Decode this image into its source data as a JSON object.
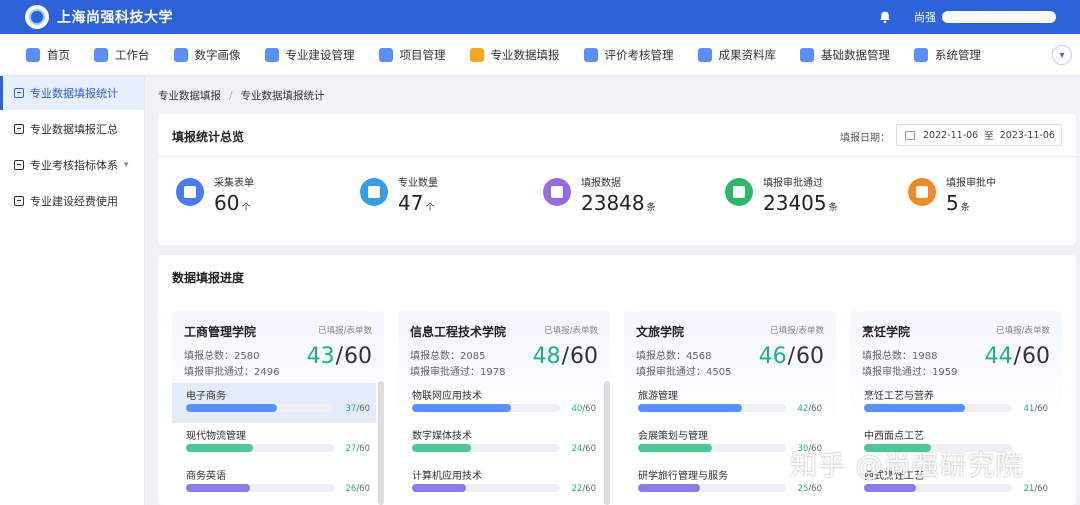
{
  "header": {
    "brand": "上海尚强科技大学",
    "user_label": "尚强"
  },
  "nav": {
    "items": [
      {
        "label": "首页",
        "color": "#5b8ff9"
      },
      {
        "label": "工作台",
        "color": "#5b8ff9"
      },
      {
        "label": "数字画像",
        "color": "#5b8ff9"
      },
      {
        "label": "专业建设管理",
        "color": "#5b8ff9"
      },
      {
        "label": "项目管理",
        "color": "#5b8ff9"
      },
      {
        "label": "专业数据填报",
        "color": "#f5a623"
      },
      {
        "label": "评价考核管理",
        "color": "#5b8ff9"
      },
      {
        "label": "成果资料库",
        "color": "#5b8ff9"
      },
      {
        "label": "基础数据管理",
        "color": "#5b8ff9"
      },
      {
        "label": "系统管理",
        "color": "#5b8ff9"
      }
    ]
  },
  "sidebar": {
    "items": [
      {
        "label": "专业数据填报统计"
      },
      {
        "label": "专业数据填报汇总"
      },
      {
        "label": "专业考核指标体系"
      },
      {
        "label": "专业建设经费使用"
      }
    ]
  },
  "breadcrumb": {
    "first": "专业数据填报",
    "sep": "/",
    "second": "专业数据填报统计"
  },
  "overview": {
    "title": "填报统计总览",
    "date_label": "填报日期：",
    "date_start": "2022-11-06",
    "date_sep": "至",
    "date_end": "2023-11-06",
    "stats": [
      {
        "label": "采集表单",
        "value": "60",
        "unit": "个",
        "color": "#4a7be8"
      },
      {
        "label": "专业数量",
        "value": "47",
        "unit": "个",
        "color": "#3a9be8"
      },
      {
        "label": "填报数据",
        "value": "23848",
        "unit": "条",
        "color": "#9a6be0"
      },
      {
        "label": "填报审批通过",
        "value": "23405",
        "unit": "条",
        "color": "#2fb86a"
      },
      {
        "label": "填报审批中",
        "value": "5",
        "unit": "条",
        "color": "#f08a24"
      }
    ]
  },
  "progress": {
    "title": "数据填报进度",
    "colleges": [
      {
        "name": "工商管理学院",
        "note": "已填报/表单数",
        "total": "填报总数：2580",
        "approved": "填报审批通过：2496",
        "score": "43",
        "slash": "/",
        "out_of": "60",
        "majors": [
          {
            "name": "电子商务",
            "done": "37",
            "total": "/60",
            "progress": 0.6167,
            "color": "#5b8ff9"
          },
          {
            "name": "现代物流管理",
            "done": "27",
            "total": "/60",
            "progress": 0.45,
            "color": "#52c49a"
          },
          {
            "name": "商务英语",
            "done": "26",
            "total": "/60",
            "progress": 0.4333,
            "color": "#8c7ae6"
          }
        ]
      },
      {
        "name": "信息工程技术学院",
        "note": "已填报/表单数",
        "total": "填报总数：2085",
        "approved": "填报审批通过：1978",
        "score": "48",
        "slash": "/",
        "out_of": "60",
        "majors": [
          {
            "name": "物联网应用技术",
            "done": "40",
            "total": "/60",
            "progress": 0.6667,
            "color": "#5b8ff9"
          },
          {
            "name": "数字媒体技术",
            "done": "24",
            "total": "/60",
            "progress": 0.4,
            "color": "#52c49a"
          },
          {
            "name": "计算机应用技术",
            "done": "22",
            "total": "/60",
            "progress": 0.3667,
            "color": "#8c7ae6"
          }
        ]
      },
      {
        "name": "文旅学院",
        "note": "已填报/表单数",
        "total": "填报总数：4568",
        "approved": "填报审批通过：4505",
        "score": "46",
        "slash": "/",
        "out_of": "60",
        "majors": [
          {
            "name": "旅游管理",
            "done": "42",
            "total": "/60",
            "progress": 0.7,
            "color": "#5b8ff9"
          },
          {
            "name": "会展策划与管理",
            "done": "30",
            "total": "/60",
            "progress": 0.5,
            "color": "#52c49a"
          },
          {
            "name": "研学旅行管理与服务",
            "done": "25",
            "total": "/60",
            "progress": 0.4167,
            "color": "#8c7ae6"
          }
        ]
      },
      {
        "name": "烹饪学院",
        "note": "已填报/表单数",
        "total": "填报总数：1988",
        "approved": "填报审批通过：1959",
        "score": "44",
        "slash": "/",
        "out_of": "60",
        "majors": [
          {
            "name": "烹饪工艺与营养",
            "done": "41",
            "total": "/60",
            "progress": 0.6833,
            "color": "#5b8ff9"
          },
          {
            "name": "中西面点工艺",
            "done": "",
            "total": "",
            "progress": 0.45,
            "color": "#52c49a"
          },
          {
            "name": "西式烹饪工艺",
            "done": "21",
            "total": "/60",
            "progress": 0.35,
            "color": "#8c7ae6"
          }
        ]
      }
    ]
  },
  "watermark": "知乎 @尚强研究院"
}
